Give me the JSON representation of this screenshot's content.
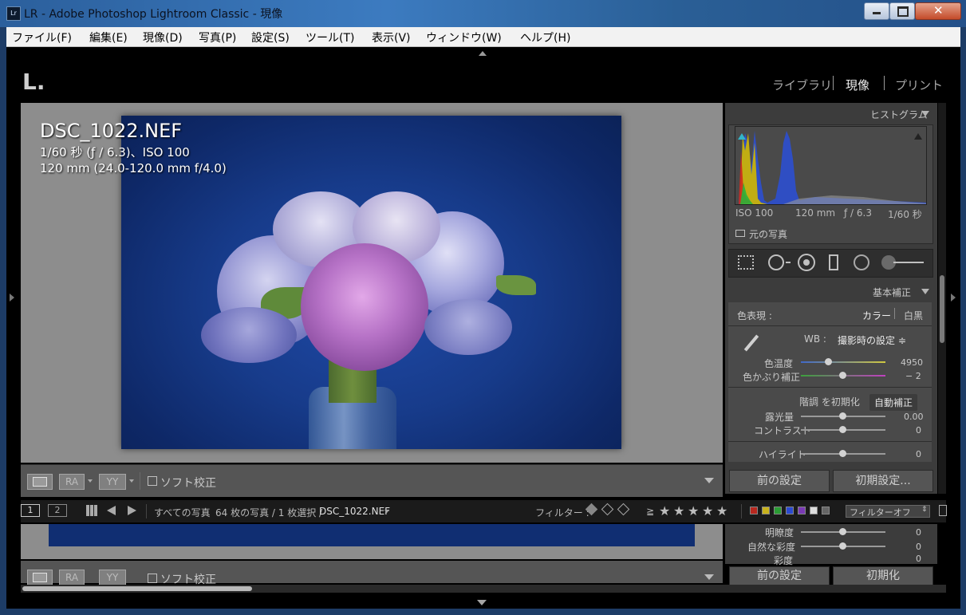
{
  "window": {
    "app_badge": "Lr",
    "title": "LR - Adobe Photoshop Lightroom Classic - 現像"
  },
  "menu": [
    "ファイル(F)",
    "編集(E)",
    "現像(D)",
    "写真(P)",
    "設定(S)",
    "ツール(T)",
    "表示(V)",
    "ウィンドウ(W)",
    "ヘルプ(H)"
  ],
  "header": {
    "logo": "L.",
    "modules": [
      "ライブラリ",
      "現像",
      "プリント"
    ],
    "active_module": "現像"
  },
  "photo": {
    "filename": "DSC_1022.NEF",
    "exposure_line": "1/60 秒 (ƒ / 6.3)、ISO 100",
    "lens_line": "120 mm (24.0-120.0 mm f/4.0)"
  },
  "toolbar": {
    "view_ra": "RA",
    "view_yy": "YY",
    "soft_proof": "ソフト校正"
  },
  "histogram": {
    "title": "ヒストグラム",
    "iso": "ISO 100",
    "focal": "120 mm",
    "aperture": "ƒ / 6.3",
    "shutter": "1/60 秒",
    "original_photo": "元の写真"
  },
  "basic": {
    "title": "基本補正",
    "treatment_label": "色表現 :",
    "color": "カラー",
    "bw": "白黒",
    "wb_label": "WB :",
    "wb_value": "撮影時の設定 ≑",
    "temp_label": "色温度",
    "temp_value": "4950",
    "tint_label": "色かぶり補正",
    "tint_value": "− 2",
    "tone_label": "階調 を初期化",
    "auto": "自動補正",
    "exposure_label": "露光量",
    "exposure_value": "0.00",
    "contrast_label": "コントラスト",
    "contrast_value": "0",
    "highlights_label": "ハイライト",
    "highlights_value": "0"
  },
  "buttons": {
    "previous": "前の設定",
    "reset": "初期設定..."
  },
  "filmstrip": {
    "page1": "1",
    "page2": "2",
    "all_photos": "すべての写真",
    "count": "64 枚の写真 / 1 枚選択 /",
    "file": "DSC_1022.NEF",
    "filter_label": "フィルター :",
    "gte": "≧",
    "filter_off": "フィルターオフ"
  },
  "dup_panel": {
    "clarity_label": "明瞭度",
    "clarity_value": "0",
    "vibrance_label": "自然な彩度",
    "vibrance_value": "0",
    "saturation_label": "彩度",
    "saturation_value": "0",
    "previous": "前の設定",
    "reset": "初期化",
    "view_ra": "RA",
    "view_yy": "YY",
    "soft_proof": "ソフト校正"
  },
  "colors": {
    "accent_blue": "#1f4aa8",
    "panel": "#3c3c3c",
    "canvas": "#8d8d8d"
  }
}
